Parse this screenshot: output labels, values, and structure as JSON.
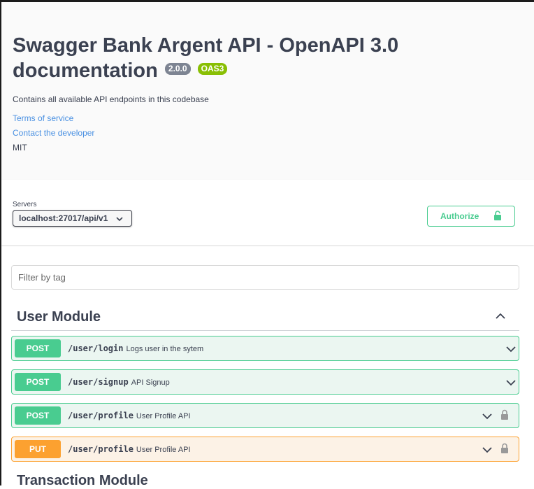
{
  "info": {
    "title": "Swagger Bank Argent API - OpenAPI 3.0 documentation",
    "version_badge": "2.0.0",
    "oas_badge": "OAS3",
    "description": "Contains all available API endpoints in this codebase",
    "terms_link": "Terms of service",
    "contact_link": "Contact the developer",
    "license": "MIT"
  },
  "servers": {
    "label": "Servers",
    "selected": "localhost:27017/api/v1"
  },
  "authorize": {
    "label": "Authorize"
  },
  "filter": {
    "placeholder": "Filter by tag"
  },
  "sections": [
    {
      "title": "User Module",
      "operations": [
        {
          "method": "POST",
          "path": "/user/login",
          "summary": "Logs user in the sytem",
          "locked": false
        },
        {
          "method": "POST",
          "path": "/user/signup",
          "summary": "API Signup",
          "locked": false
        },
        {
          "method": "POST",
          "path": "/user/profile",
          "summary": "User Profile API",
          "locked": true
        },
        {
          "method": "PUT",
          "path": "/user/profile",
          "summary": "User Profile API",
          "locked": true
        }
      ]
    },
    {
      "title": "Transaction Module"
    }
  ],
  "colors": {
    "post": "#49cc90",
    "put": "#fca130",
    "link": "#4990e2",
    "oas_badge": "#89bf04",
    "version_badge": "#7d8492"
  }
}
